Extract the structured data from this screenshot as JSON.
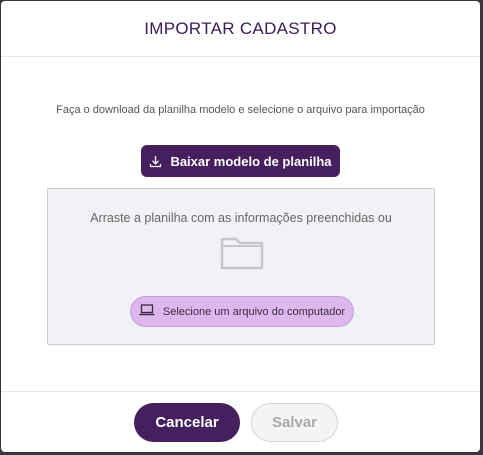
{
  "modal": {
    "title": "IMPORTAR CADASTRO",
    "instruction": "Faça o download da planilha modelo e selecione o arquivo para importação",
    "download_button": {
      "label": "Baixar modelo de planilha",
      "icon": "download-icon"
    },
    "dropzone": {
      "text": "Arraste a planilha com as informações preenchidas ou",
      "icon": "folder-icon",
      "select_button": {
        "label": "Selecione um arquivo do computador",
        "icon": "laptop-icon"
      }
    },
    "footer": {
      "cancel_label": "Cancelar",
      "save_label": "Salvar",
      "save_disabled": true
    }
  },
  "colors": {
    "primary": "#451f5e",
    "accent_light": "#dcb8ef",
    "dropzone_bg": "#f1f2f5",
    "disabled": "#a9a9a9"
  }
}
